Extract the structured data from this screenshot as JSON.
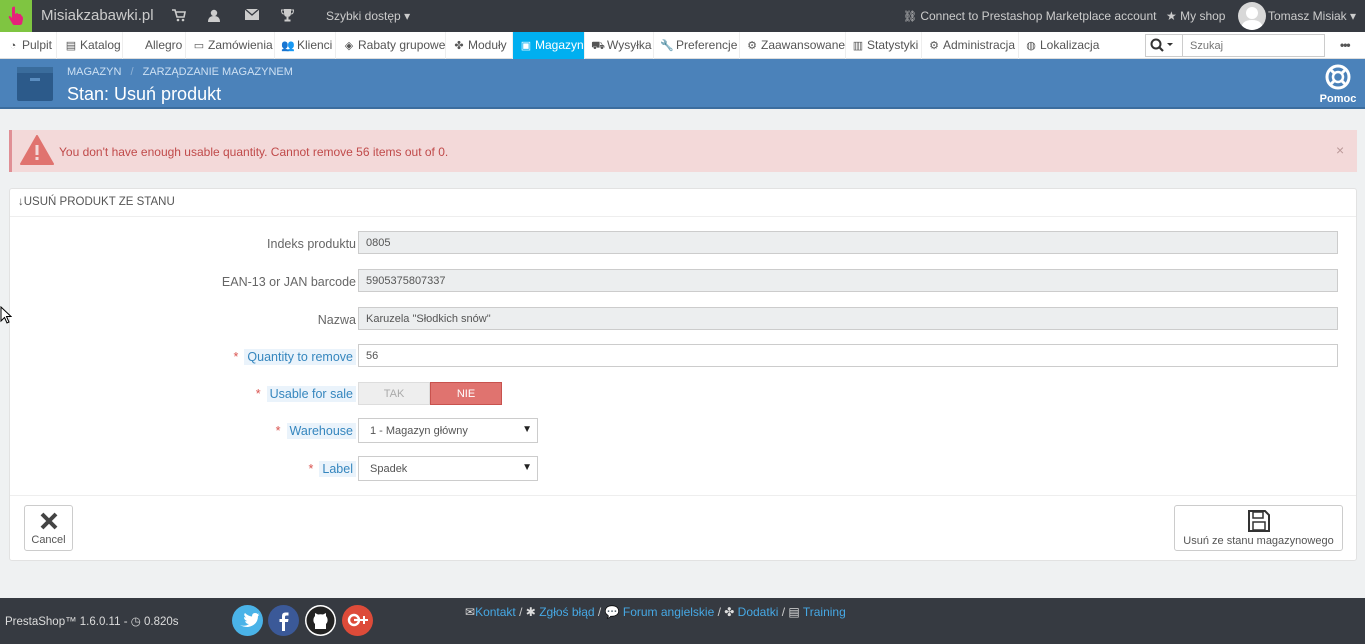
{
  "topbar": {
    "shop_name": "Misiakzabawki.pl",
    "quick_access": "Szybki dostęp",
    "marketplace": "Connect to Prestashop Marketplace account",
    "my_shop": "My shop",
    "user": "Tomasz Misiak"
  },
  "nav": {
    "items": [
      {
        "label": "Pulpit",
        "icon": "dashboard-icon"
      },
      {
        "label": "Katalog",
        "icon": "book-icon"
      },
      {
        "label": "Allegro",
        "icon": ""
      },
      {
        "label": "Zamówienia",
        "icon": "credit-card-icon"
      },
      {
        "label": "Klienci",
        "icon": "users-icon"
      },
      {
        "label": "Rabaty grupowe",
        "icon": "tag-icon"
      },
      {
        "label": "Moduły",
        "icon": "puzzle-icon"
      },
      {
        "label": "Magazyn",
        "icon": "archive-icon",
        "active": true
      },
      {
        "label": "Wysyłka",
        "icon": "truck-icon"
      },
      {
        "label": "Preferencje",
        "icon": "wrench-icon"
      },
      {
        "label": "Zaawansowane",
        "icon": "cogs-icon"
      },
      {
        "label": "Statystyki",
        "icon": "bar-chart-icon"
      },
      {
        "label": "Administracja",
        "icon": "cog-icon"
      },
      {
        "label": "Lokalizacja",
        "icon": "globe-icon"
      }
    ],
    "search_placeholder": "Szukaj"
  },
  "header": {
    "breadcrumb_1": "MAGAZYN",
    "breadcrumb_sep": "/",
    "breadcrumb_2": "ZARZĄDZANIE MAGAZYNEM",
    "title": "Stan: Usuń produkt",
    "help": "Pomoc"
  },
  "alert": {
    "text": "You don't have enough usable quantity. Cannot remove 56 items out of 0.",
    "close": "×"
  },
  "panel": {
    "title": "USUŃ PRODUKT ZE STANU",
    "fields": {
      "reference_label": "Indeks produktu",
      "reference_value": "0805",
      "ean_label": "EAN-13 or JAN barcode",
      "ean_value": "5905375807337",
      "name_label": "Nazwa",
      "name_value": "Karuzela \"Słodkich snów\"",
      "quantity_label": "Quantity to remove",
      "quantity_value": "56",
      "usable_label": "Usable for sale",
      "usable_yes": "TAK",
      "usable_no": "NIE",
      "warehouse_label": "Warehouse",
      "warehouse_value": "1 - Magazyn główny",
      "label_label": "Label",
      "label_value": "Spadek"
    },
    "cancel": "Cancel",
    "save": "Usuń ze stanu magazynowego"
  },
  "footer": {
    "version": "PrestaShop™ 1.6.0.11 - ",
    "time": "0.820s",
    "links": [
      "Kontakt",
      "Zgłoś błąd",
      "Forum angielskie",
      "Dodatki",
      "Training"
    ]
  },
  "colors": {
    "accent": "#00aff0",
    "header_bg": "#4b82ba",
    "alert_bg": "#f3d9d9",
    "danger": "#e0736f"
  }
}
